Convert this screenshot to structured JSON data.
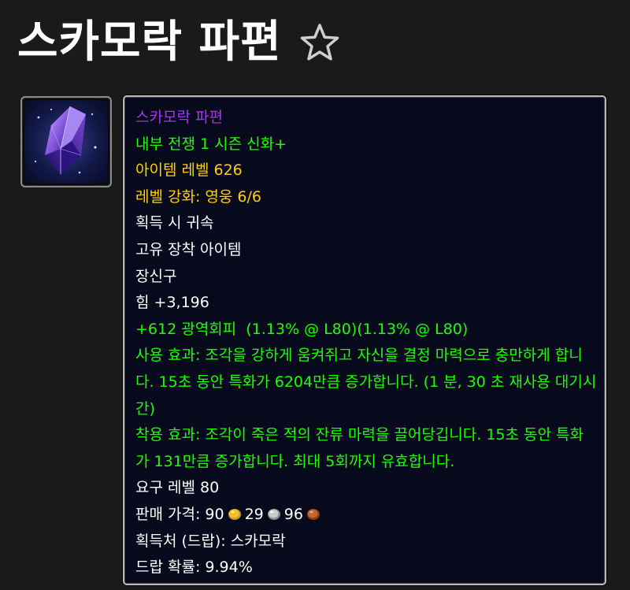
{
  "page": {
    "title": "스카모락 파편",
    "favorite_icon": "star-outline-icon"
  },
  "item": {
    "icon": "purple-crystal-shard-icon",
    "name": "스카모락 파편",
    "season_tag": "내부 전쟁 1 시즌 신화+",
    "item_level": "아이템 레벨 626",
    "upgrade_level": "레벨 강화: 영웅 6/6",
    "binding": "획득 시 귀속",
    "unique": "고유 장착 아이템",
    "slot": "장신구",
    "stat_strength": "힘 +3,196",
    "stat_avoidance": "+612 광역회피  (1.13% @ L80)(1.13% @ L80)",
    "use_effect": "사용 효과: 조각을 강하게 움켜쥐고 자신을 결정 마력으로 충만하게 합니다. 15초 동안 특화가 6204만큼 증가합니다. (1 분, 30 초 재사용 대기시간)",
    "equip_effect": "착용 효과: 조각이 죽은 적의 잔류 마력을 끌어당깁니다. 15초 동안 특화가 131만큼 증가합니다. 최대 5회까지 유효합니다.",
    "required_level": "요구 레벨 80",
    "sell_price_label": "판매 가격: ",
    "sell_price_gold": "90",
    "sell_price_silver": "29",
    "sell_price_copper": "96",
    "source": "획득처 (드랍): 스카모락",
    "drop_rate": "드랍 확률: 9.94%"
  },
  "colors": {
    "epic": "#a335ee",
    "green": "#1eff00",
    "yellow": "#ffd100",
    "white": "#ffffff",
    "gold_coin": "#f2c12e",
    "silver_coin": "#c9c9c9",
    "copper_coin": "#c2662d"
  }
}
